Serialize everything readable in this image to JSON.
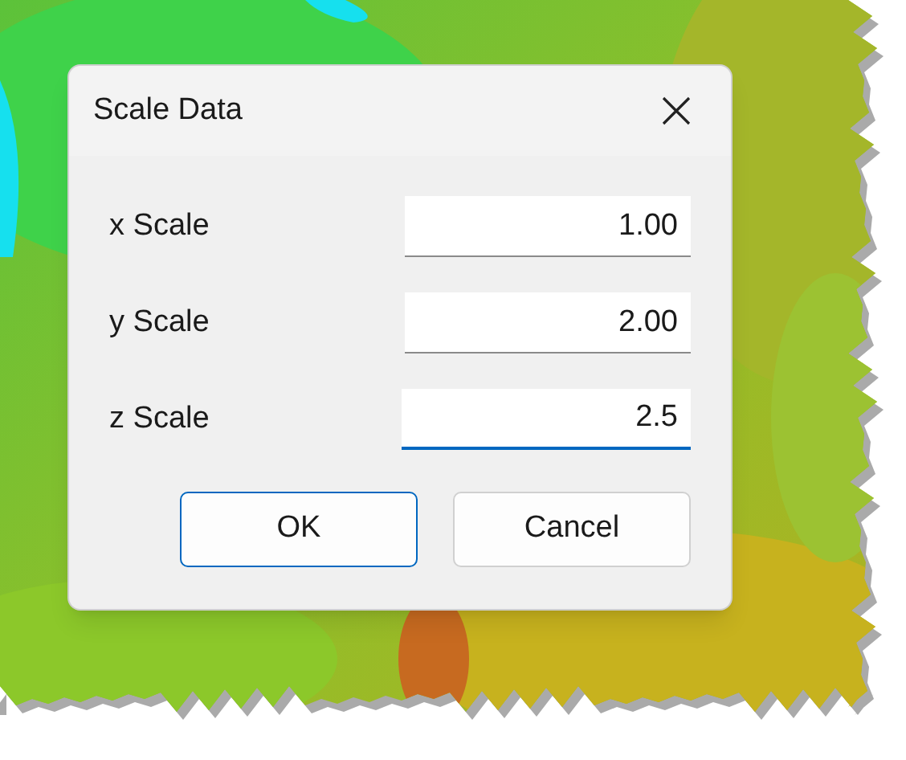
{
  "dialog": {
    "title": "Scale Data",
    "fields": [
      {
        "label": "x Scale",
        "value": "1.00",
        "selected": false
      },
      {
        "label": "y Scale",
        "value": "2.00",
        "selected": false
      },
      {
        "label": "z Scale",
        "value": "2.5",
        "selected": true
      }
    ],
    "buttons": [
      {
        "label": "OK",
        "default": true
      },
      {
        "label": "Cancel",
        "default": false
      }
    ]
  }
}
